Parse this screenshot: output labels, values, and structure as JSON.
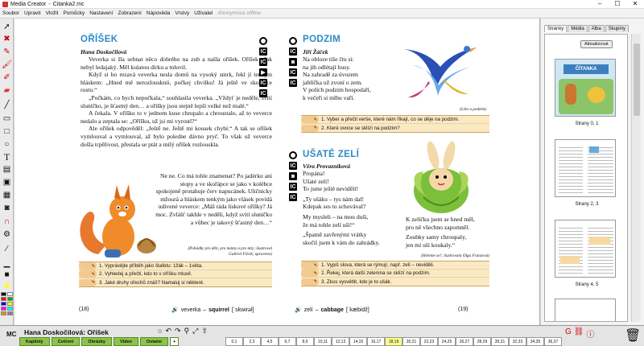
{
  "window": {
    "app": "Media Creator",
    "doc_file": "Citanka2.mc",
    "title_sep": " - "
  },
  "menu": [
    "Soubor",
    "Upravit",
    "Vložit",
    "Pomůcky",
    "Nastavení",
    "Zobrazení",
    "Nápověda",
    "Vrstvy",
    "Uživatel"
  ],
  "menu_status": "Anonymous offline",
  "left_page": {
    "title": "OŘÍŠEK",
    "author": "Hana Doskočilová",
    "paragraphs": [
      "Veverka si šla sehnat něco dobrého na zub a našla oříšek. Oříšek však nebyl ledajaký. Měl kulatou dírku a mluvil.",
      "Když si ho rezavá veverka nesla domů na vysoký smrk, řekl jí tenkým hláskem: „Hned mě nerozlousknii, počkej chvilku! Já ještě ve skořápce rostu.“",
      "„Počkám, co bych nepočkala,“ souhlasila veverka. „Vždyť je neděle, svítí sluníčko, je šťastný den… a oříšky jsou stejně lepší velké než malé.“",
      "A čekala. V oříšku to v jednom kuse chrupalo a chroustalo, až to veverce nedalo a zeptala se: „Oříšku, už jsi mi vyrostl?“",
      "Ale oříšek odpověděl: „Ještě ne. Ještě mi kousek chybí.“ A tak se oříšek vymlouval a vymlouval, až bylo poledne dávno pryč. To však už veverce došla trpělivost, přestala se ptát a milý oříšek rozlouskla."
    ],
    "side_text": "Ne ne. Co má tohle znamenat? Po jadérku ani stopy a ve skořápce se jako v kolébce spokojeně protahuje červ napucánek. Uličnicky mžourá a hláskem tenkým jako vlásek povídá udivené veverce: „Máš ráda liskové oříšky? Já moc. Zvlášť takhle v neděli, když svítí sluníčko a vůbec je takový šťastný den…“",
    "source": "(Pohádky pro děti, pro mámy a pro táty; ilustroval Gabriel Filcík; upraveno)",
    "tasks": [
      "1. Vyprávějte příběh jako štafetu: 1žák – 1věta.",
      "2. Vyhledej a přečti, kdo to v oříšku mluvil.",
      "3. Jaké druhy ořechů znáš? Namaluj si některé."
    ],
    "page_num": "(18)",
    "vocab_word": "veverka",
    "vocab_en": "squirrel",
    "vocab_ipa": "[ˈskwirəl]"
  },
  "right_page": {
    "poem1_title": "PODZIM",
    "poem1_author": "Jiří Žáček",
    "poem1_lines": [
      "Na obloze tiše čtu si:",
      "na jih odlétají husy.",
      "Na zahradě za úvozem",
      "jablíčka už zvoní o zem.",
      "V polích podzim hospodaří,",
      "k večeři si mlhu vaří."
    ],
    "poem1_source": "(Léto a podzim)",
    "poem1_tasks": [
      "1. Vyber a přečti verše, které nám říkají, co se děje na podzim.",
      "2. Které ovoce se sklízí na podzim?"
    ],
    "poem2_title": "UŠATÉ ZELÍ",
    "poem2_author": "Věra Provazníková",
    "poem2_lines_a": [
      "Propána!",
      "Ušaté zelí!",
      "To jsme ještě neviděli!",
      "„Ty ušáku – tys nám dal!",
      "Kdepak ses to schovával?",
      "My mysleli – na mou duši,",
      "že má tohle zelí uši!“",
      "„Špatně zavřenými vrátky",
      "skočil jsem k vám do zahrádky."
    ],
    "poem2_lines_b": [
      "K zelíčku jsem se hned měl,",
      "pro ně všechno zapomněl.",
      "Zoubky samy chroupaly,",
      "jen mi uši koukaly.“"
    ],
    "poem2_source": "(Heleme se!; ilustrovala Olga Franzová)",
    "poem2_tasks": [
      "1. Vypiš slova, která se rýmují, např. zelí – neviděli.",
      "2. Řekej, která další zelenina se sklízí na podzim.",
      "3. Zkus vysvětlit, kdo je to ušák."
    ],
    "page_num": "(19)",
    "vocab_word": "zelí",
    "vocab_en": "cabbage",
    "vocab_ipa": "[ˈkæbidž]"
  },
  "right_panel": {
    "tabs": [
      "Stránky",
      "Média",
      "Alba",
      "Skupiny"
    ],
    "update_btn": "Aktualizovat",
    "thumbs": [
      "Strany 0, 1",
      "Strany 2, 3",
      "Strany 4, 5"
    ],
    "thumb_title": "ČÍTANKA"
  },
  "bottom": {
    "mc": "MC",
    "doc_title": "Hana Doskočilová: Oříšek",
    "categories": [
      "Kapitoly",
      "Cvičení",
      "Obrázky",
      "Video",
      "Ostatní"
    ],
    "pages": [
      "0,1",
      "2,3",
      "4,5",
      "6,7",
      "8,9",
      "10,11",
      "12,13",
      "14,15",
      "16,17",
      "18,19",
      "20,21",
      "22,23",
      "24,25",
      "26,27",
      "28,29",
      "30,31",
      "32,33",
      "34,35",
      "36,37"
    ],
    "current_page": "18,19"
  }
}
